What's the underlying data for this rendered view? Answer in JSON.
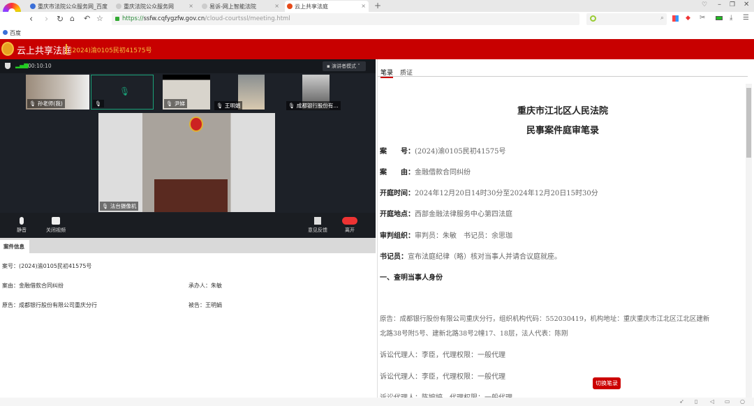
{
  "browser": {
    "tabs": [
      {
        "title": "重庆市法院公众服务网_百度"
      },
      {
        "title": "重庆法院公众服务网"
      },
      {
        "title": "易诉-网上智能法院"
      },
      {
        "title": "云上共享法庭"
      }
    ],
    "url_prefix": "https://",
    "url_host": "ssfw.cqfygzfw.gov.cn",
    "url_path": "/cloud-courtssl/meeting.html",
    "bookmark": "百度"
  },
  "header": {
    "title": "云上共享法庭",
    "case_no": "(2024)渝0105民初41575号"
  },
  "video": {
    "timer": "00:10:10",
    "mode": "演讲者模式",
    "participants": [
      {
        "name": "孙老师(我)"
      },
      {
        "name": ""
      },
      {
        "name": "尹娣"
      },
      {
        "name": "王明娟"
      },
      {
        "name": "成都银行股份有..."
      }
    ],
    "main": "法台摄像机",
    "controls": {
      "mute": "静音",
      "video": "关闭视频",
      "feedback": "意见反馈",
      "leave": "离开"
    }
  },
  "case_info": {
    "tab": "案件信息",
    "case_no": "案号：(2024)渝0105民初41575号",
    "cause": "案由：金融借款合同纠纷",
    "handler": "承办人：朱敏",
    "plaintiff": "原告：成都银行股份有限公司重庆分行",
    "defendant": "被告：王明娟"
  },
  "notes": {
    "tabs": [
      "笔录",
      "质证"
    ],
    "court": "重庆市江北区人民法院",
    "doc_title": "民事案件庭审笔录",
    "fields": [
      {
        "k": "案　　号：",
        "v": "(2024)渝0105民初41575号"
      },
      {
        "k": "案　　由：",
        "v": "金融借款合同纠纷"
      },
      {
        "k": "开庭时间：",
        "v": "2024年12月20日14时30分至2024年12月20日15时30分"
      },
      {
        "k": "开庭地点：",
        "v": "西部金融法律服务中心第四法庭"
      },
      {
        "k": "审判组织：",
        "v": "审判员：朱敏　书记员：余思珈"
      },
      {
        "k": "书记员：",
        "v": "宣布法庭纪律（略）核对当事人并请合议庭就座。"
      }
    ],
    "section": "一、查明当事人身份",
    "plaintiff_line1": "原告：成都银行股份有限公司重庆分行，组织机构代码：552030419，机构地址：重庆重庆市江北区江北区建新",
    "plaintiff_line2": "北路38号附5号、建新北路38号2幢17、18层，法人代表：陈刚",
    "agents": [
      "诉讼代理人：李臣，代理权限：一般代理",
      "诉讼代理人：李臣，代理权限：一般代理",
      "诉讼代理人：陈婉婷，代理权限：一般代理"
    ],
    "switch": "切换笔录"
  }
}
